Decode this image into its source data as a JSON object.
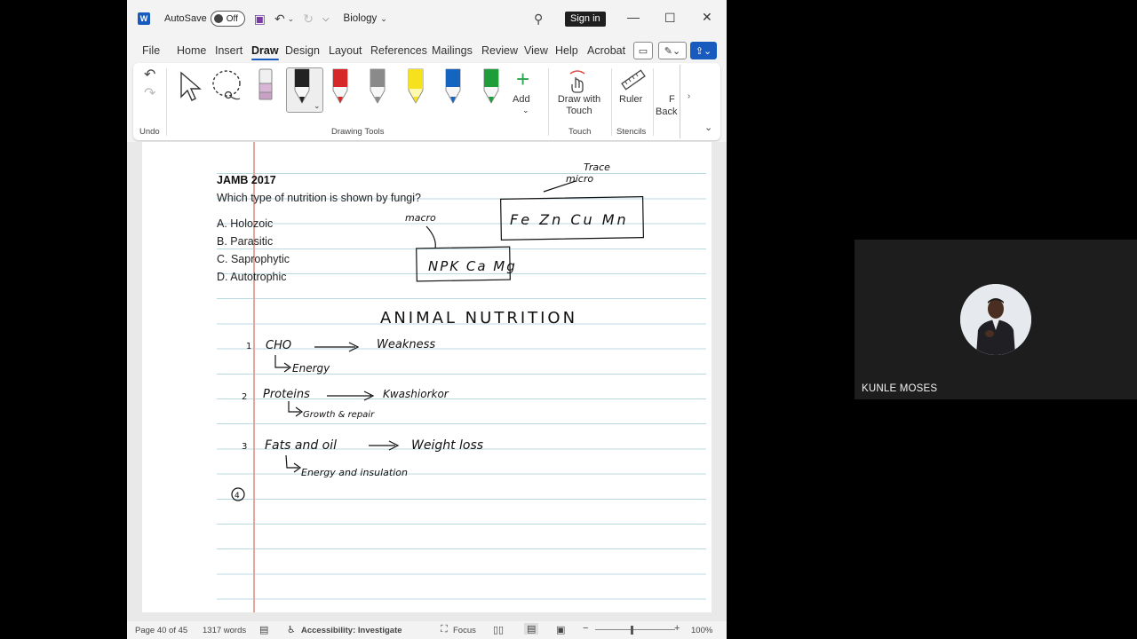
{
  "titlebar": {
    "autosave_label": "AutoSave",
    "autosave_state": "Off",
    "doc_title": "Biology",
    "signin_label": "Sign in"
  },
  "tabs": [
    "File",
    "Home",
    "Insert",
    "Draw",
    "Design",
    "Layout",
    "References",
    "Mailings",
    "Review",
    "View",
    "Help",
    "Acrobat"
  ],
  "active_tab": "Draw",
  "ribbon": {
    "undo_group_label": "Undo",
    "drawing_tools_label": "Drawing Tools",
    "add_label": "Add",
    "draw_with_touch_label": "Draw with Touch",
    "ruler_label": "Ruler",
    "touch_group_label": "Touch",
    "stencils_group_label": "Stencils",
    "background_partial": "Back",
    "background_partial_top": "F",
    "pen_colors": [
      "#222222",
      "#d62828",
      "#8a8a8a",
      "#f5e11d",
      "#1565c0",
      "#1e9e3a"
    ],
    "accent": "#185abd"
  },
  "document": {
    "question_title": "JAMB 2017",
    "question_text": "Which type of nutrition is shown by fungi?",
    "options": [
      "A. Holozoic",
      "B. Parasitic",
      "C. Saprophytic",
      "D. Autotrophic"
    ],
    "ink_text": {
      "trace": "Trace",
      "micro": "micro",
      "macro": "macro",
      "micro_box": "Fe Zn Cu Mn",
      "macro_box": "NPK Ca Mg",
      "heading": "ANIMAL NUTRITION",
      "n1": "1",
      "item1": "CHO",
      "item1_result": "Weakness",
      "item1_sub": "Energy",
      "n2": "2",
      "item2": "Proteins",
      "item2_result": "Kwashiorkor",
      "item2_sub": "Growth & repair",
      "n3": "3",
      "item3": "Fats and oil",
      "item3_result": "Weight loss",
      "item3_sub": "Energy and insulation",
      "n4": "4"
    }
  },
  "statusbar": {
    "page": "Page 40 of 45",
    "words": "1317 words",
    "accessibility": "Accessibility: Investigate",
    "focus": "Focus",
    "zoom": "100%"
  },
  "video": {
    "speaker_name": "KUNLE MOSES"
  }
}
